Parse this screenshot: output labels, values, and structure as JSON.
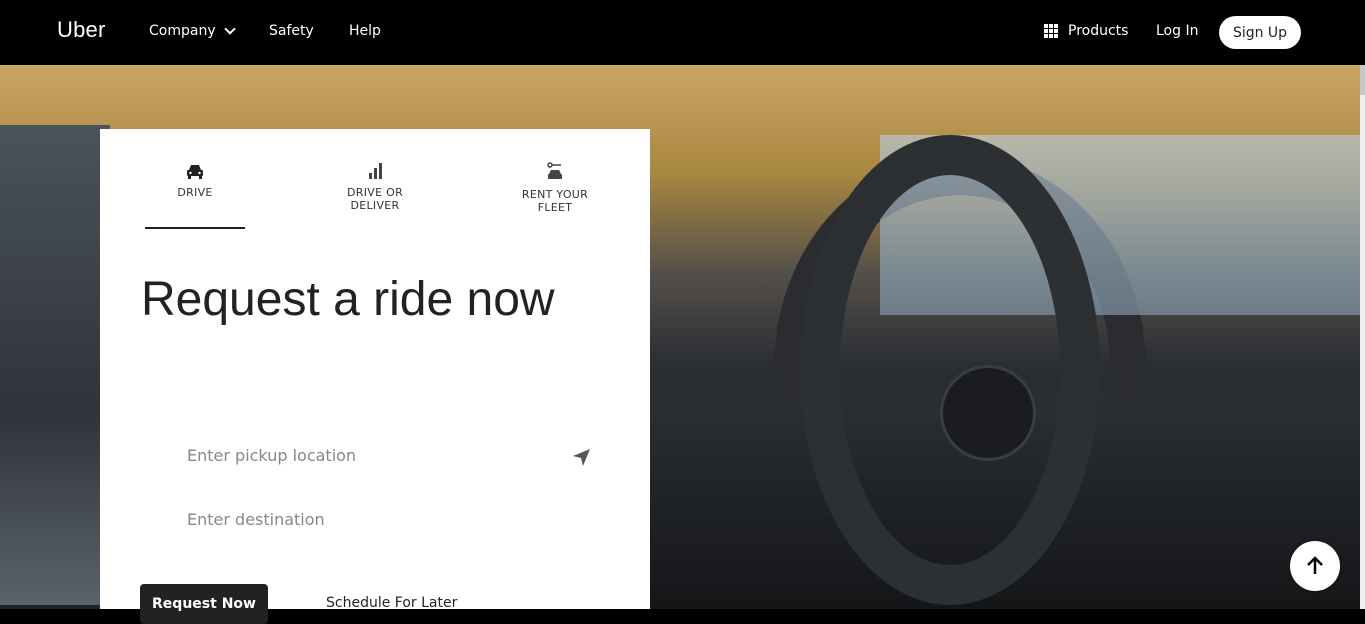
{
  "header": {
    "logo": "Uber",
    "nav": [
      {
        "label": "Company"
      },
      {
        "label": "Safety"
      },
      {
        "label": "Help"
      }
    ],
    "products_label": "Products",
    "login_label": "Log In",
    "signup_label": "Sign Up"
  },
  "card": {
    "tabs": [
      {
        "label": "DRIVE",
        "icon": "car-icon"
      },
      {
        "label": "DRIVE OR DELIVER",
        "icon": "bar-chart-icon"
      },
      {
        "label": "RENT YOUR FLEET",
        "icon": "fleet-icon"
      }
    ],
    "headline": "Request a ride now",
    "pickup_placeholder": "Enter pickup location",
    "destination_placeholder": "Enter destination",
    "request_label": "Request Now",
    "schedule_label": "Schedule For Later"
  },
  "hero_image": "car-interior-steering-wheel",
  "colors": {
    "nav_bg": "#000000",
    "card_bg": "#ffffff",
    "button_bg": "#222222"
  }
}
